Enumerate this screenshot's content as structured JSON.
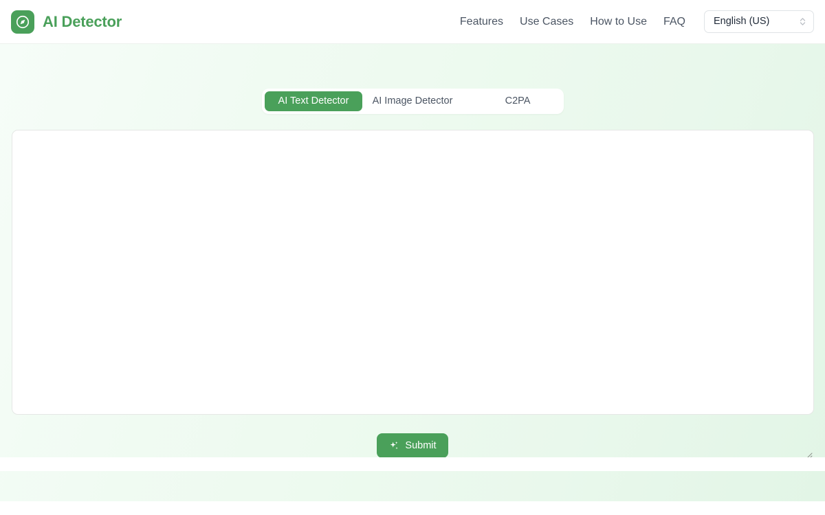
{
  "header": {
    "brand": {
      "name": "AI Detector",
      "logo_icon": "compass-icon",
      "accent_color": "#4aa05a"
    },
    "nav": [
      {
        "label": "Features"
      },
      {
        "label": "Use Cases"
      },
      {
        "label": "How to Use"
      },
      {
        "label": "FAQ"
      }
    ],
    "language_select": {
      "value": "English (US)",
      "icon": "chevron-updown-icon"
    }
  },
  "main": {
    "tabs": [
      {
        "label": "AI Text Detector",
        "active": true
      },
      {
        "label": "AI Image Detector",
        "active": false
      },
      {
        "label": "C2PA",
        "active": false
      }
    ],
    "input": {
      "value": "",
      "placeholder": ""
    },
    "submit": {
      "label": "Submit",
      "icon": "sparkles-icon",
      "color": "#4aa05a"
    }
  },
  "theme": {
    "accent": "#4aa05a",
    "page_background_from": "#f6fdf8",
    "page_background_to": "#e2f5e6",
    "header_background": "#ffffff",
    "nav_text": "#4b5563"
  }
}
